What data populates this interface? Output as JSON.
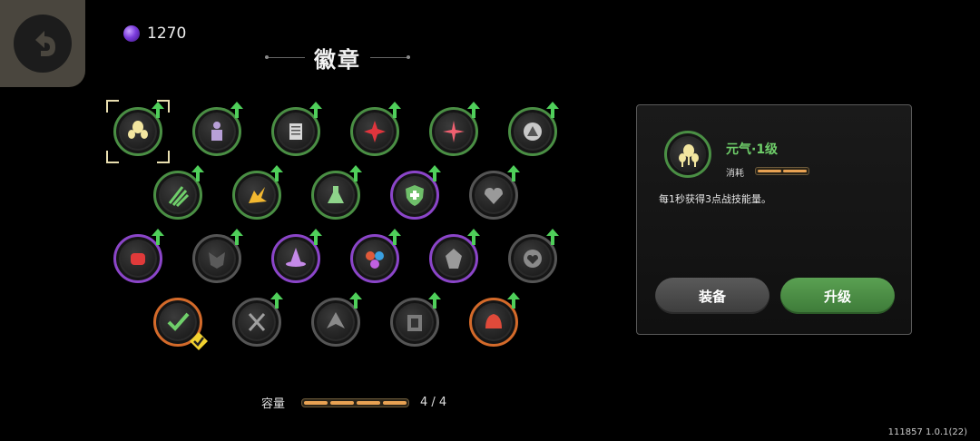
{
  "currency": {
    "amount": "1270",
    "icon": "purple-gem-icon"
  },
  "title": "徽章",
  "badges": [
    {
      "id": "yuanqi",
      "icon": "spirit-bubbles-icon",
      "ring": "#4a8f44",
      "selected": true,
      "upgradable": true,
      "equipped": false
    },
    {
      "id": "b2",
      "icon": "pawn-icon",
      "ring": "#4a8f44",
      "upgradable": true
    },
    {
      "id": "b3",
      "icon": "scroll-icon",
      "ring": "#4a8f44",
      "upgradable": true
    },
    {
      "id": "b4",
      "icon": "red-star-icon",
      "ring": "#4a8f44",
      "upgradable": true
    },
    {
      "id": "b5",
      "icon": "red-sparkle-icon",
      "ring": "#4a8f44",
      "upgradable": true
    },
    {
      "id": "b6",
      "icon": "triangle-coin-icon",
      "ring": "#4a8f44",
      "upgradable": true
    },
    {
      "id": "b7",
      "icon": "green-claws-icon",
      "ring": "#4a8f44",
      "upgradable": true
    },
    {
      "id": "b8",
      "icon": "burst-icon",
      "ring": "#4a8f44",
      "upgradable": true
    },
    {
      "id": "b9",
      "icon": "flask-icon",
      "ring": "#4a8f44",
      "upgradable": true
    },
    {
      "id": "b10",
      "icon": "shield-plus-icon",
      "ring": "#8b45c9",
      "upgradable": true
    },
    {
      "id": "b11",
      "icon": "heart-icon",
      "ring": "#555555",
      "upgradable": true
    },
    {
      "id": "b12",
      "icon": "fist-icon",
      "ring": "#8b45c9",
      "upgradable": true
    },
    {
      "id": "b13",
      "icon": "dark-mask-icon",
      "ring": "#555555",
      "upgradable": true
    },
    {
      "id": "b14",
      "icon": "witch-hat-icon",
      "ring": "#8b45c9",
      "upgradable": true
    },
    {
      "id": "b15",
      "icon": "tri-swirl-icon",
      "ring": "#8b45c9",
      "upgradable": true
    },
    {
      "id": "b16",
      "icon": "crystal-icon",
      "ring": "#8b45c9",
      "upgradable": true
    },
    {
      "id": "b17",
      "icon": "heart-coin-icon",
      "ring": "#555555",
      "upgradable": true
    },
    {
      "id": "b18",
      "icon": "checkmark-icon",
      "ring": "#d46a2a",
      "upgradable": false,
      "equipped": true
    },
    {
      "id": "b19",
      "icon": "scissors-icon",
      "ring": "#555555",
      "upgradable": true
    },
    {
      "id": "b20",
      "icon": "arrowhead-icon",
      "ring": "#555555",
      "upgradable": true
    },
    {
      "id": "b21",
      "icon": "gate-icon",
      "ring": "#555555",
      "upgradable": true
    },
    {
      "id": "b22",
      "icon": "red-helmet-icon",
      "ring": "#d46a2a",
      "upgradable": true
    }
  ],
  "capacity": {
    "label": "容量",
    "used": 4,
    "total": 4,
    "text": "4 / 4"
  },
  "detail": {
    "name": "元气·1级",
    "cost_label": "消耗",
    "cost": 2,
    "description": "每1秒获得3点战技能量。",
    "equip_label": "装备",
    "upgrade_label": "升级"
  },
  "version": "111857 1.0.1(22)",
  "colors": {
    "accent_green": "#6fcf6a",
    "bar_orange": "#e8a253"
  }
}
